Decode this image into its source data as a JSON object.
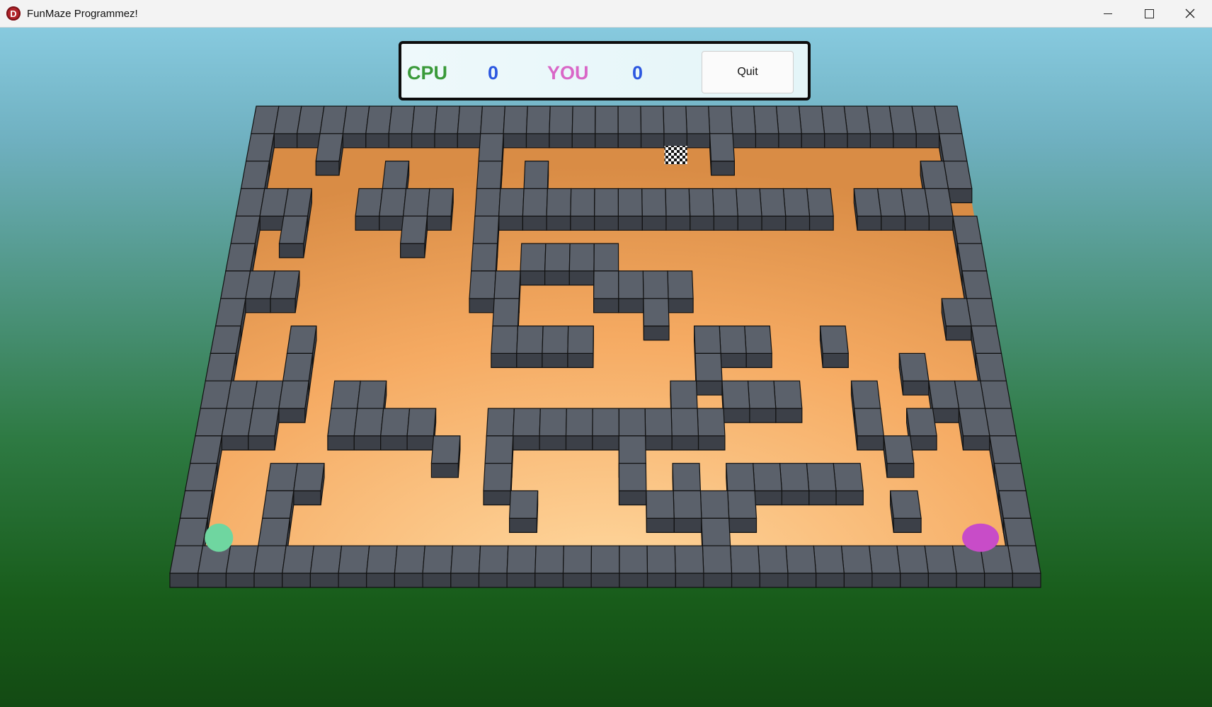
{
  "window": {
    "title": "FunMaze Programmez!",
    "app_icon_letter": "D",
    "minimize_icon": "minimize-icon",
    "maximize_icon": "maximize-icon",
    "close_icon": "close-icon"
  },
  "scoreboard": {
    "cpu_label": "CPU",
    "cpu_score": "0",
    "you_label": "YOU",
    "you_score": "0",
    "quit_label": "Quit"
  },
  "game": {
    "maze_columns": 31,
    "maze_rows": 16,
    "walls": [
      "###############################",
      "#..#......#.........#.........#",
      "#.....#...#.#................##",
      "###..####.###############.####",
      "#.#....#..#...................#",
      "#.........#.####..............#",
      "###.......##...####...........#",
      "#..........#.....#...........##",
      "#..#.......####....###..#.....#",
      "#..#...............#.......#..#",
      "####.##...........#.###..#..###",
      "###..####..#########.....#.#.###",
      "#........#.#....#.........#...#",
      "#..##......#....#.#.#####.....###",
      "#..#........#....####.....#...#",
      "#..#...............#..........#",
      "###############################"
    ],
    "player_color": "#c84cc8",
    "cpu_color": "#6fd6a0",
    "goal_icon": "checkered-flag-icon"
  },
  "colors": {
    "block_top": "#5b616b",
    "block_side": "#3c4048",
    "floor_light": "#ffd29a",
    "floor_dark": "#d98c45"
  }
}
